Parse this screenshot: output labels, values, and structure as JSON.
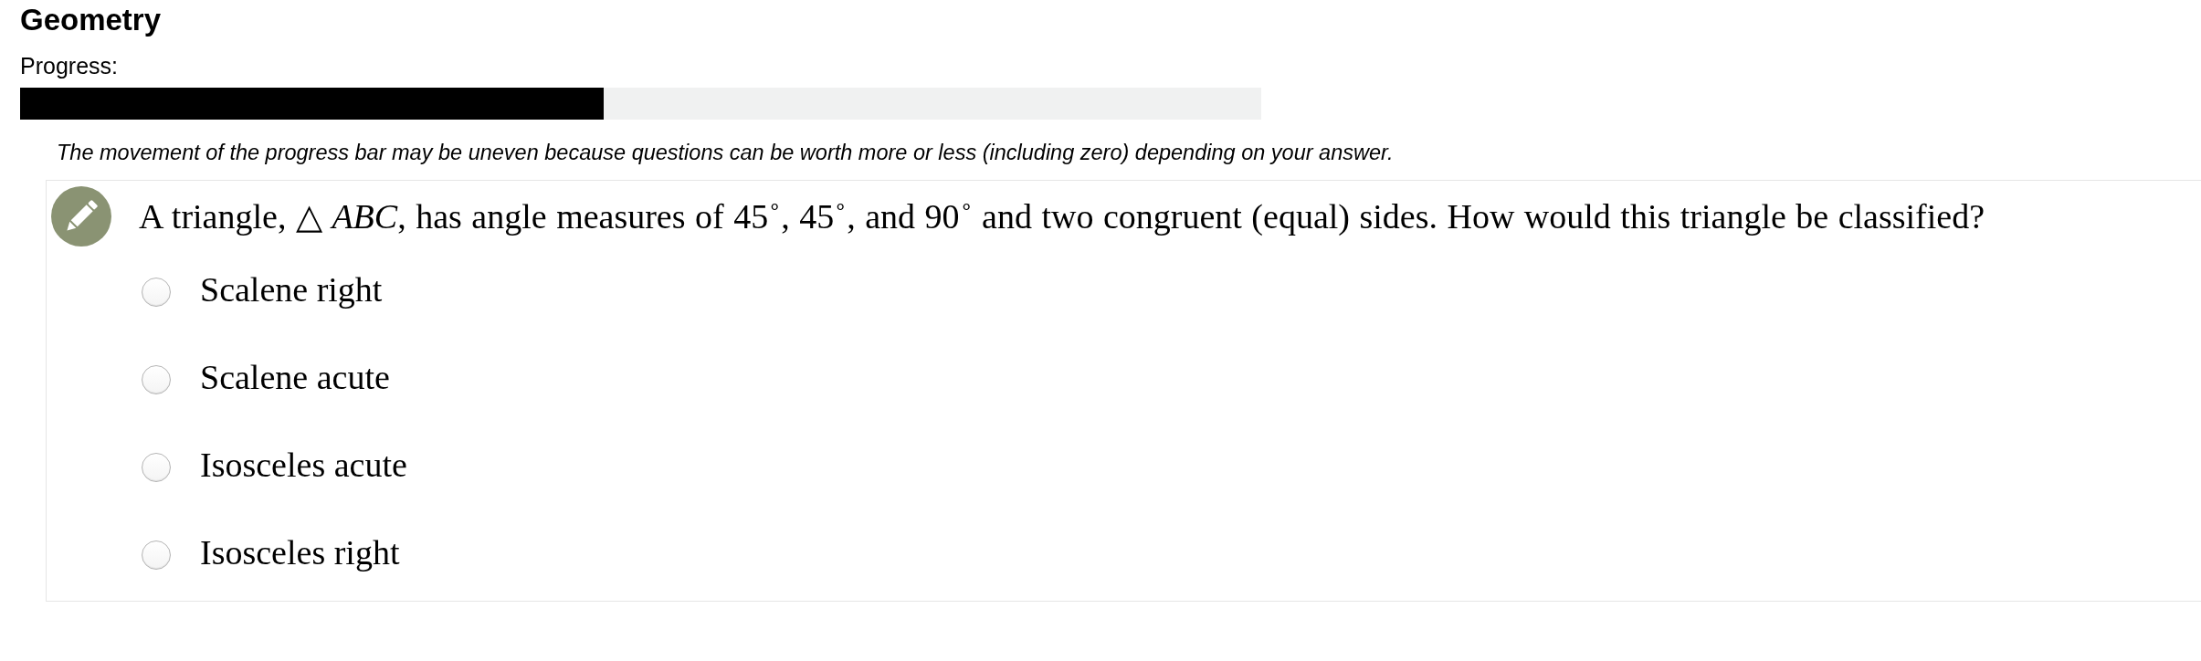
{
  "title": "Geometry",
  "progress": {
    "label": "Progress:",
    "level": 0.47
  },
  "note": "The movement of the progress bar may be uneven because questions can be worth more or less (including zero) depending on your answer.",
  "question": {
    "text": "A triangle,  △ *ABC*, has angle measures of 45$^{∘}$, 45$^{∘}$, and 90$^{∘}$ and two congruent (equal) sides. How would this triangle be classified?",
    "options": [
      {
        "label": "Scalene right",
        "selected": false
      },
      {
        "label": "Scalene acute",
        "selected": false
      },
      {
        "label": "Isosceles acute",
        "selected": false
      },
      {
        "label": "Isosceles right",
        "selected": false
      }
    ]
  }
}
